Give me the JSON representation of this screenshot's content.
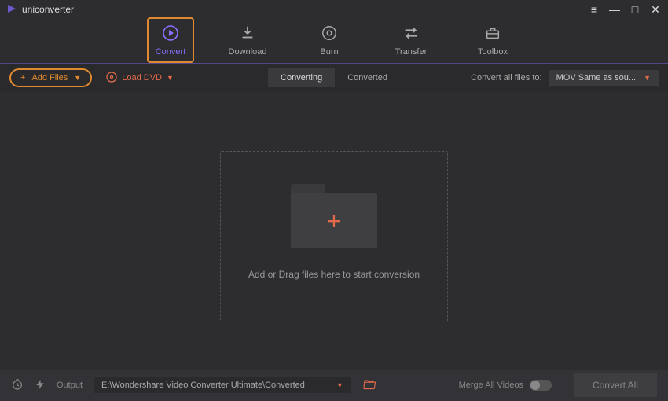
{
  "app": {
    "title": "uniconverter"
  },
  "nav": {
    "convert": "Convert",
    "download": "Download",
    "burn": "Burn",
    "transfer": "Transfer",
    "toolbox": "Toolbox"
  },
  "toolbar": {
    "add_files": "Add Files",
    "load_dvd": "Load DVD",
    "converting": "Converting",
    "converted": "Converted",
    "convert_all_to": "Convert all files to:",
    "format_selected": "MOV Same as sou..."
  },
  "dropzone": {
    "text": "Add or Drag files here to start conversion"
  },
  "footer": {
    "output_label": "Output",
    "output_path": "E:\\Wondershare Video Converter Ultimate\\Converted",
    "merge_label": "Merge All Videos",
    "convert_all": "Convert All"
  }
}
